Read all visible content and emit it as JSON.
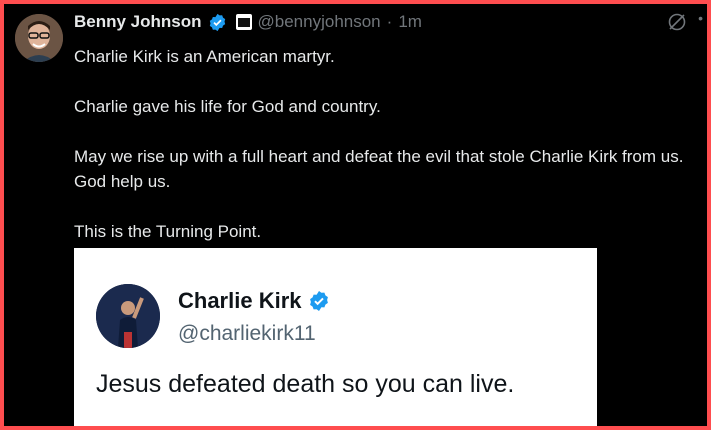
{
  "post": {
    "author_name": "Benny Johnson",
    "handle": "@bennyjohnson",
    "separator": "·",
    "time": "1m",
    "paragraphs": [
      "Charlie Kirk is an American martyr.",
      "Charlie gave his life for God and country.",
      "May we rise up with a full heart and defeat the evil that stole Charlie Kirk from us. God help us.",
      "This is the Turning Point."
    ]
  },
  "embedded_post": {
    "author_name": "Charlie Kirk",
    "handle": "@charliekirk11",
    "text": "Jesus defeated death so you can live."
  },
  "icons": {
    "verified": "verified-badge-icon",
    "affiliate": "affiliate-badge-icon",
    "grok": "grok-icon",
    "more": "more-dots-icon"
  },
  "colors": {
    "border": "#ff4d4f",
    "background": "#000000",
    "verified_blue": "#1d9bf0",
    "secondary_text": "#71767b"
  }
}
